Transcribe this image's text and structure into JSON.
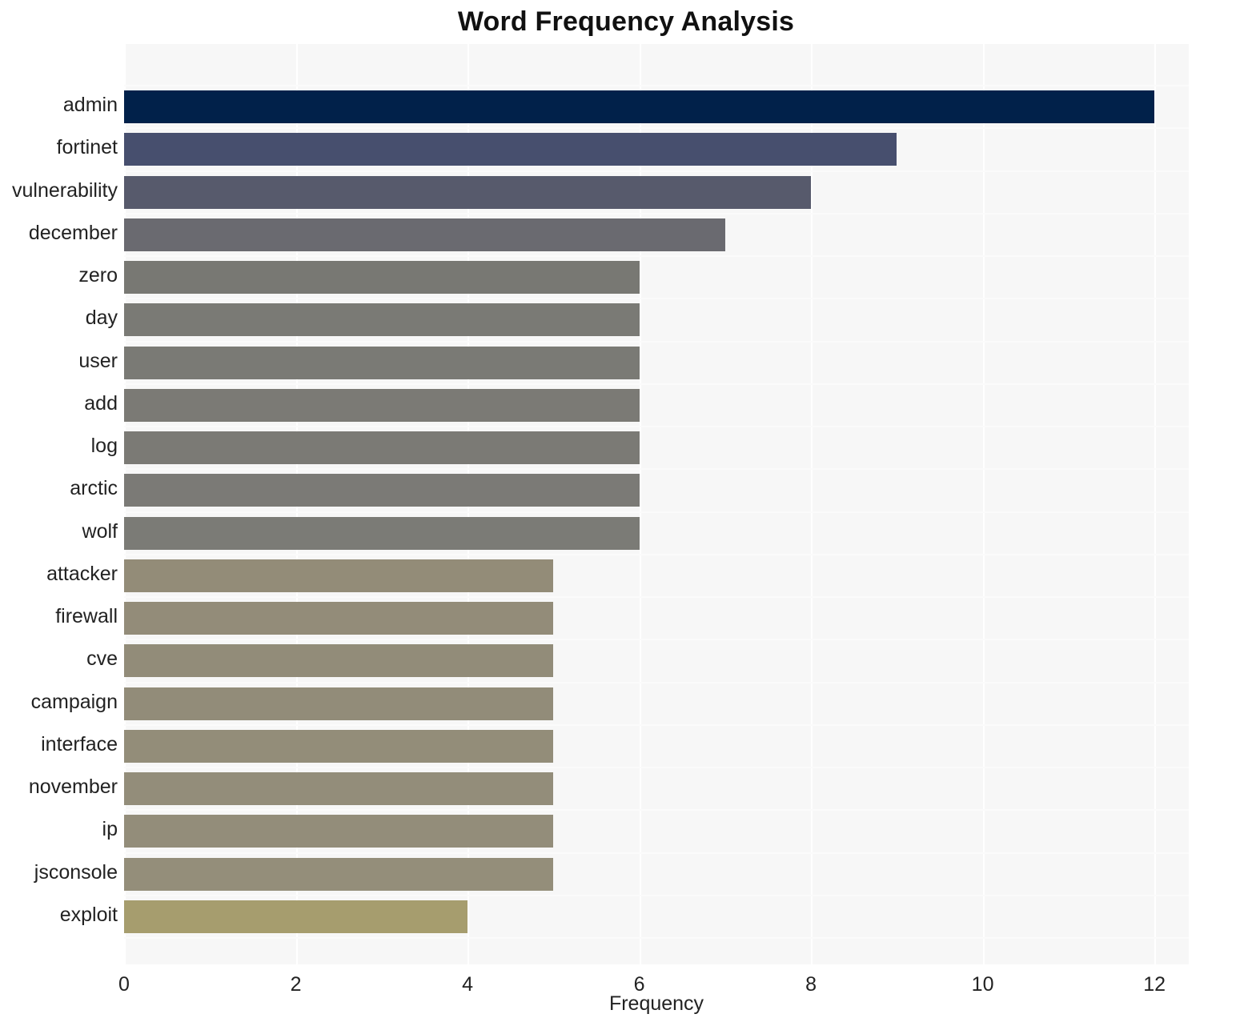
{
  "chart_data": {
    "type": "bar",
    "orientation": "horizontal",
    "title": "Word Frequency Analysis",
    "xlabel": "Frequency",
    "ylabel": "",
    "xlim": [
      0,
      12.4
    ],
    "xticks": [
      0,
      2,
      4,
      6,
      8,
      10,
      12
    ],
    "xtick_labels": [
      "0",
      "2",
      "4",
      "6",
      "8",
      "10",
      "12"
    ],
    "grid": true,
    "legend": null,
    "categories": [
      "admin",
      "fortinet",
      "vulnerability",
      "december",
      "zero",
      "day",
      "user",
      "add",
      "log",
      "arctic",
      "wolf",
      "attacker",
      "firewall",
      "cve",
      "campaign",
      "interface",
      "november",
      "ip",
      "jsconsole",
      "exploit"
    ],
    "values": [
      12,
      9,
      8,
      7,
      6,
      6,
      6,
      6,
      6,
      6,
      6,
      5,
      5,
      5,
      5,
      5,
      5,
      5,
      5,
      4
    ],
    "bar_colors": [
      "#01214a",
      "#474f6e",
      "#575a6c",
      "#6a6a70",
      "#787873",
      "#7a7a75",
      "#7a7a75",
      "#7b7a75",
      "#7b7a75",
      "#7b7a76",
      "#7b7b76",
      "#938c78",
      "#938c79",
      "#928c79",
      "#928c79",
      "#938d79",
      "#938d7a",
      "#938d7a",
      "#948e7a",
      "#a69d6e"
    ],
    "plot_background": "#f7f7f7",
    "gridline_color": "#ffffff",
    "figure_background": "#ffffff"
  }
}
